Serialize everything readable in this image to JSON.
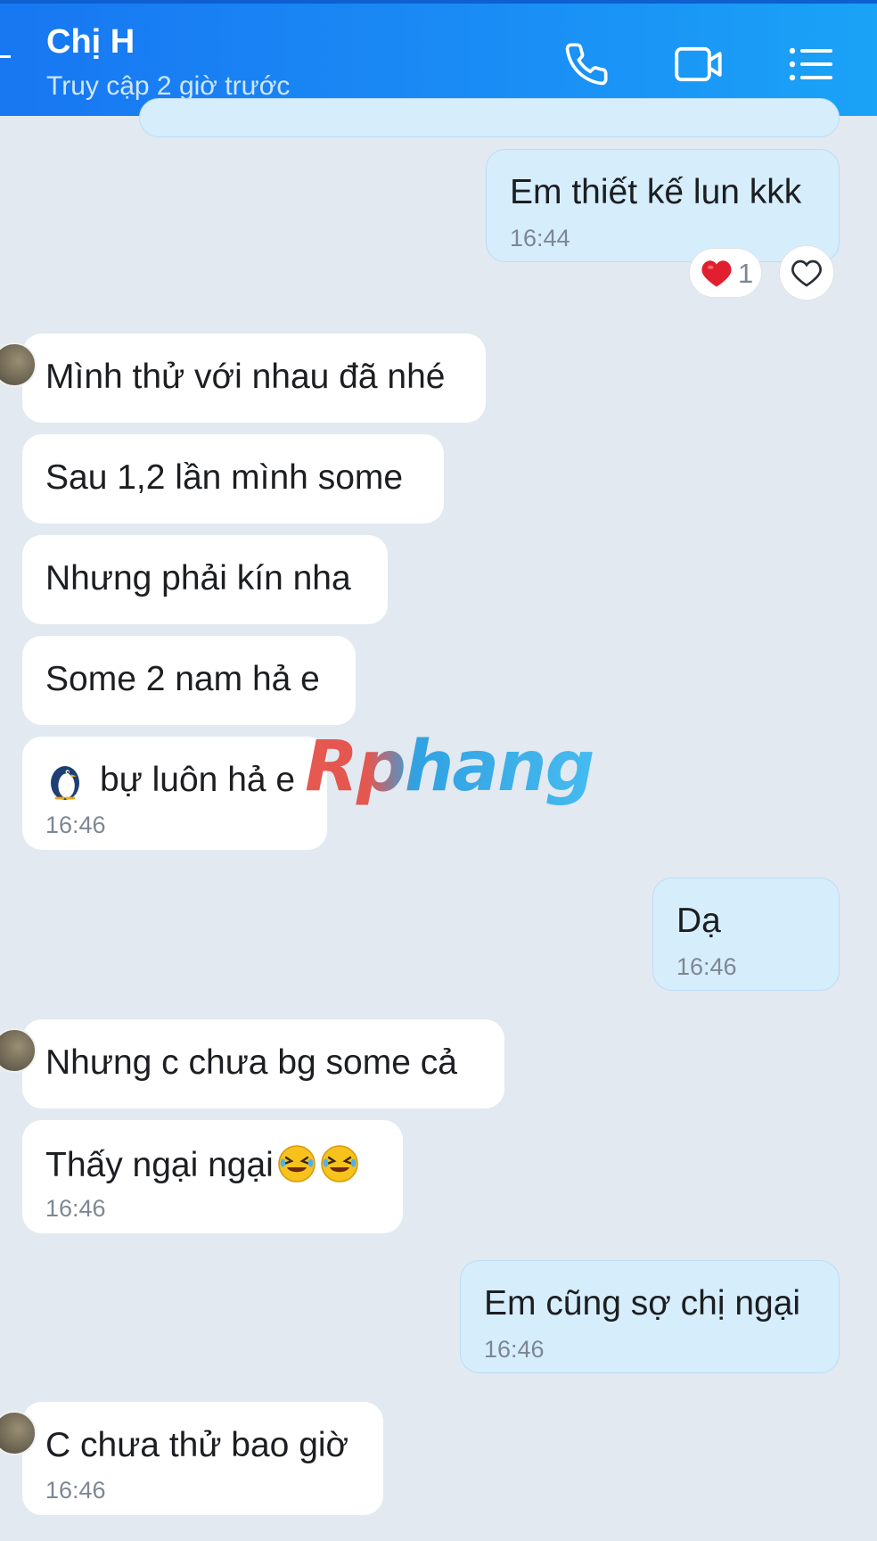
{
  "header": {
    "contact_name": "Chị H",
    "status": "Truy cập 2 giờ trước",
    "icons": [
      "phone-icon",
      "video-call-icon",
      "menu-list-icon"
    ]
  },
  "colors": {
    "header_blue": "#1877f2",
    "incoming_bubble": "#ffffff",
    "outgoing_bubble": "#d6edfc",
    "chat_background": "#e2e9f1",
    "reaction_heart": "#e0202e"
  },
  "messages": {
    "m1": {
      "text": "Em thiết kế lun kkk",
      "time": "16:44",
      "direction": "out"
    },
    "m1_reaction": {
      "emoji": "heart",
      "count": "1"
    },
    "m2": {
      "text": "Mình thử với nhau đã nhé",
      "direction": "in"
    },
    "m3": {
      "text": "Sau 1,2 lần mình some",
      "direction": "in"
    },
    "m4": {
      "text": "Nhưng phải kín nha",
      "direction": "in"
    },
    "m5": {
      "text": "Some 2 nam hả e",
      "direction": "in"
    },
    "m6": {
      "text": "bự luôn hả e",
      "time": "16:46",
      "direction": "in",
      "sticker": "penguin-icon"
    },
    "m7": {
      "text": "Dạ",
      "time": "16:46",
      "direction": "out"
    },
    "m8": {
      "text": "Nhưng c chưa bg some cả",
      "direction": "in"
    },
    "m9": {
      "text": "Thấy ngại ngại",
      "time": "16:46",
      "direction": "in",
      "emojis": [
        "rofl-emoji",
        "rofl-emoji"
      ]
    },
    "m10": {
      "text": "Em cũng sợ chị ngại",
      "time": "16:46",
      "direction": "out"
    },
    "m11": {
      "text": "C chưa thử bao giờ",
      "time": "16:46",
      "direction": "in"
    }
  },
  "watermark": {
    "text": "Rphang"
  }
}
